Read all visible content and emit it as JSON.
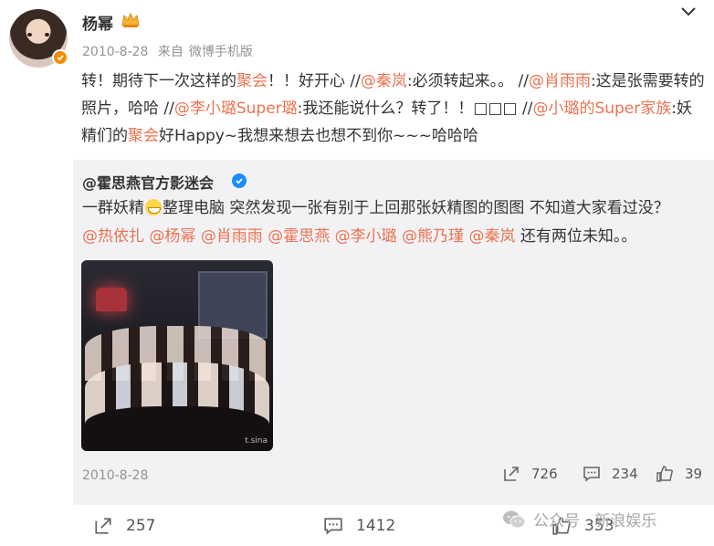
{
  "post": {
    "username": "杨幂",
    "date": "2010-8-28",
    "source_label": "来自",
    "source": "微博手机版",
    "text_segments": [
      {
        "t": "转！期待下一次这样的",
        "hl": false
      },
      {
        "t": "聚会",
        "hl": true
      },
      {
        "t": "！！好开心 //",
        "hl": false
      },
      {
        "t": "@秦岚",
        "hl": true
      },
      {
        "t": ":必须转起来。。 //",
        "hl": false
      },
      {
        "t": "@肖雨雨",
        "hl": true
      },
      {
        "t": ":这是张需要转的照片，哈哈 //",
        "hl": false
      },
      {
        "t": "@李小璐Super璐",
        "hl": true
      },
      {
        "t": ":我还能说什么？转了！！□□□ //",
        "hl": false
      },
      {
        "t": "@小璐的Super家族",
        "hl": true
      },
      {
        "t": ":妖精们的",
        "hl": false
      },
      {
        "t": "聚会",
        "hl": true
      },
      {
        "t": "好Happy~我想来想去也想不到你~~~哈哈哈",
        "hl": false
      }
    ]
  },
  "retweet": {
    "username": "@霍思燕官方影迷会",
    "text_before_emoji": "一群妖精",
    "text_after_emoji": "整理电脑 突然发现一张有别于上回那张妖精图的图图 不知道大家看过没？",
    "mentions": [
      "@热依扎",
      "@杨幂",
      "@肖雨雨",
      "@霍思燕",
      "@李小璐",
      "@熊乃瑾",
      "@秦岚"
    ],
    "mentions_tail": "还有两位未知。。",
    "photo_watermark": "t.sina",
    "date": "2010-8-28",
    "stats": {
      "reposts": "726",
      "comments": "234",
      "likes": "39"
    }
  },
  "footer": {
    "reposts": "257",
    "comments": "1412",
    "likes": "353"
  },
  "watermark": {
    "text": "公众号 · 新浪娱乐"
  },
  "colors": {
    "highlight": "#eb7350",
    "verified_orange": "#f78b00",
    "verified_blue": "#1a8cff",
    "retweet_bg": "#f2f2f5",
    "meta_gray": "#939393"
  },
  "icons": [
    "chevron-down-icon",
    "crown-icon",
    "verified-icon",
    "repost-icon",
    "comment-icon",
    "like-icon",
    "wechat-icon",
    "grin-emoji"
  ]
}
